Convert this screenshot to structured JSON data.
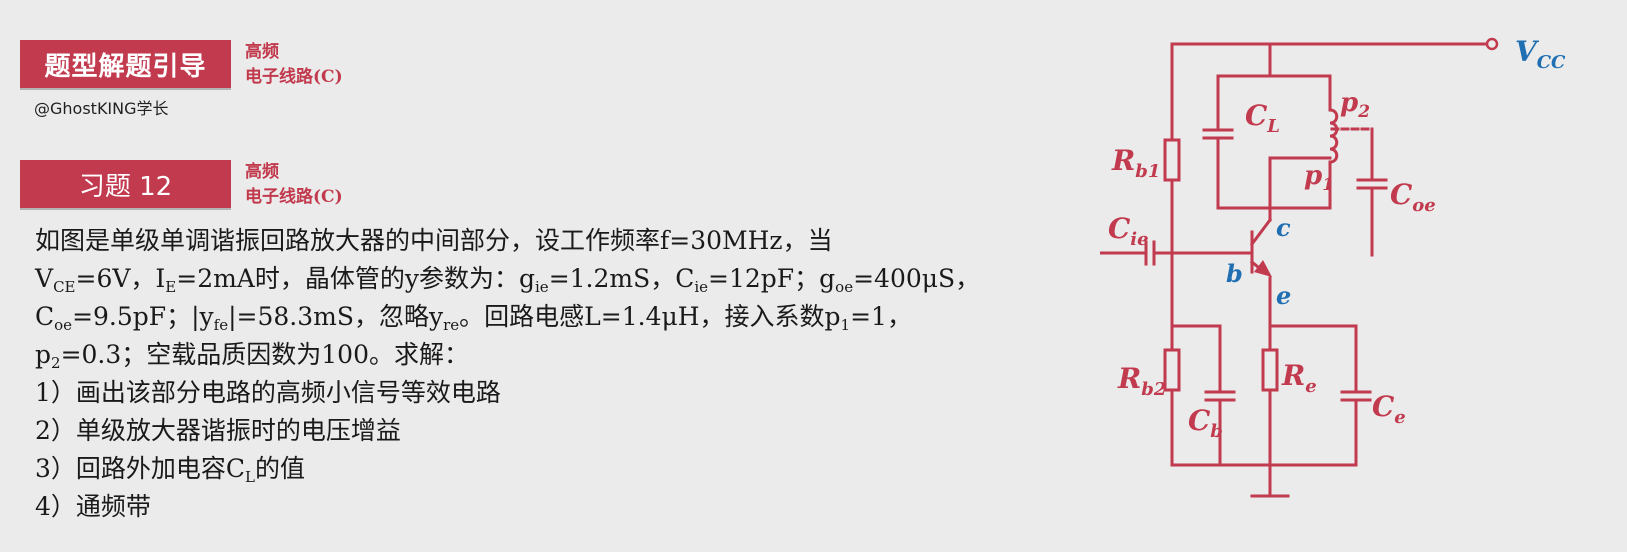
{
  "header": {
    "guide_banner": "题型解题引导",
    "course_line1": "高频",
    "course_line2": "电子线路(C)",
    "author": "@GhostKING学长"
  },
  "exercise": {
    "banner": "习题 12",
    "course_line1": "高频",
    "course_line2": "电子线路(C)"
  },
  "problem": {
    "l1": "如图是单级单调谐振回路放大器的中间部分，设工作频率f=30MHz，当",
    "l2_a": "V",
    "l2_b": "CE",
    "l2_c": "=6V，I",
    "l2_d": "E",
    "l2_e": "=2mA时，晶体管的y参数为：g",
    "l2_f": "ie",
    "l2_g": "=1.2mS，C",
    "l2_h": "ie",
    "l2_i": "=12pF；g",
    "l2_j": "oe",
    "l2_k": "=400μS，",
    "l3_a": "C",
    "l3_b": "oe",
    "l3_c": "=9.5pF；|y",
    "l3_d": "fe",
    "l3_e": "|=58.3mS，忽略y",
    "l3_f": "re",
    "l3_g": "。回路电感L=1.4μH，接入系数p",
    "l3_h": "1",
    "l3_i": "=1，",
    "l4_a": "p",
    "l4_b": "2",
    "l4_c": "=0.3；空载品质因数为100。求解：",
    "q1": "1）画出该部分电路的高频小信号等效电路",
    "q2": "2）单级放大器谐振时的电压增益",
    "q3_a": "3）回路外加电容C",
    "q3_b": "L",
    "q3_c": "的值",
    "q4": "4）通频带"
  },
  "circuit": {
    "vcc": "V",
    "vcc_sub": "CC",
    "cl": "C",
    "cl_sub": "L",
    "p2": "p",
    "p2_sub": "2",
    "p1": "p",
    "p1_sub": "1",
    "coe": "C",
    "coe_sub": "oe",
    "rb1": "R",
    "rb1_sub": "b1",
    "cie": "C",
    "cie_sub": "ie",
    "node_c": "c",
    "node_b": "b",
    "node_e": "e",
    "rb2": "R",
    "rb2_sub": "b2",
    "cb": "C",
    "cb_sub": "b",
    "re": "R",
    "re_sub": "e",
    "ce": "C",
    "ce_sub": "e",
    "wire_color": "#c23a4e",
    "node_color": "#1f6fb2"
  }
}
